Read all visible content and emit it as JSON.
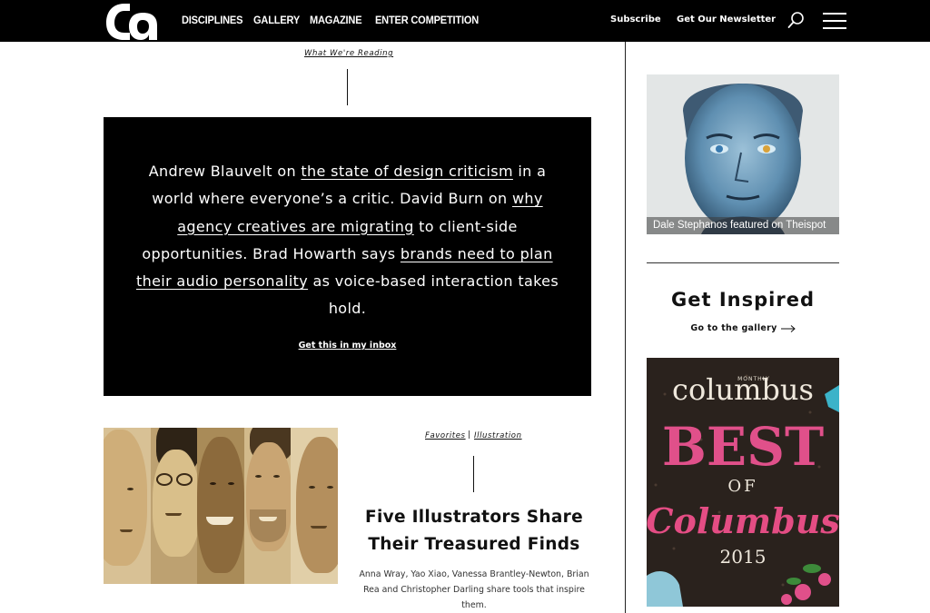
{
  "header": {
    "logo_text": "ca",
    "nav": [
      "DISCIPLINES",
      "GALLERY",
      "MAGAZINE",
      "ENTER COMPETITION"
    ],
    "subscribe": "Subscribe",
    "newsletter": "Get Our Newsletter",
    "search_icon": "search-icon",
    "menu_icon": "hamburger-menu-icon"
  },
  "reading": {
    "kicker": "What We're Reading",
    "text": {
      "p1": "Andrew Blauvelt on ",
      "l1": "the state of design criticism",
      "p2": " in a world where everyone’s a critic.  David Burn on ",
      "l2": "why agency creatives are migrating",
      "p3": " to client-side opportunities.  Brad Howarth says ",
      "l3": "brands need to plan their audio personality",
      "p4": " as voice-based interaction takes hold."
    },
    "cta": "Get this in my inbox"
  },
  "article": {
    "categories": [
      "Favorites",
      "Illustration"
    ],
    "separator": "|",
    "title": "Five Illustrators Share Their Treasured Finds",
    "dek": "Anna Wray, Yao Xiao, Vanessa Brantley-Newton, Brian Rea and Christopher Darling share tools that inspire them."
  },
  "sidebar": {
    "feature_caption": "Dale Stephanos featured on Theispot",
    "inspired_title": "Get Inspired",
    "gallery_link": "Go to the gallery",
    "arrow_icon": "arrow-right-icon",
    "cover": {
      "line1": "columbus",
      "small": "MONTHLY",
      "line2": "BEST",
      "line3": "OF",
      "line4": "Columbus",
      "year": "2015"
    }
  },
  "colors": {
    "black": "#000000",
    "white": "#ffffff",
    "sepia": "#c9ad7b",
    "portrait_blue": "#5f8fb1",
    "cover_pink": "#e0508a"
  }
}
